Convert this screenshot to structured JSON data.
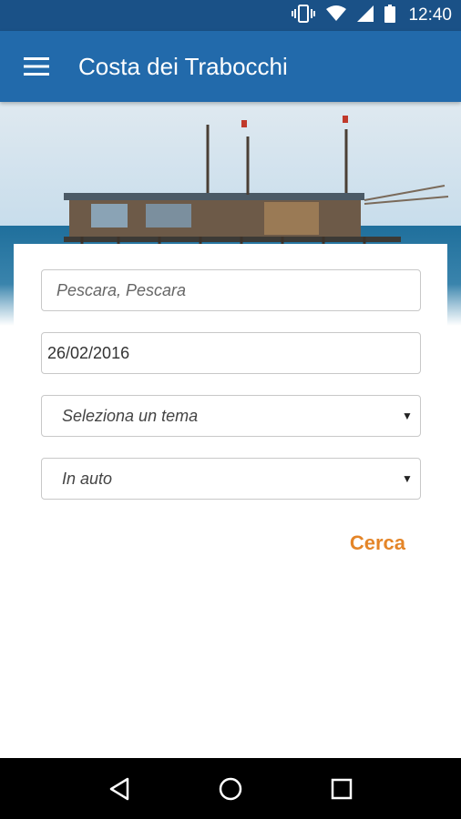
{
  "status_bar": {
    "time": "12:40",
    "icons": [
      "vibrate-icon",
      "wifi-icon",
      "signal-icon",
      "battery-icon"
    ]
  },
  "app_bar": {
    "title": "Costa dei Trabocchi",
    "menu_icon": "hamburger-menu-icon"
  },
  "form": {
    "location": {
      "value": "",
      "placeholder": "Pescara, Pescara"
    },
    "date": {
      "value": "26/02/2016"
    },
    "theme_select": {
      "selected": "Seleziona un tema"
    },
    "transport_select": {
      "selected": "In auto"
    },
    "search_label": "Cerca"
  },
  "nav_bar": {
    "icons": [
      "back-icon",
      "home-icon",
      "recents-icon"
    ]
  },
  "colors": {
    "status_bar": "#1a5187",
    "app_bar": "#226aab",
    "accent": "#e48528"
  }
}
